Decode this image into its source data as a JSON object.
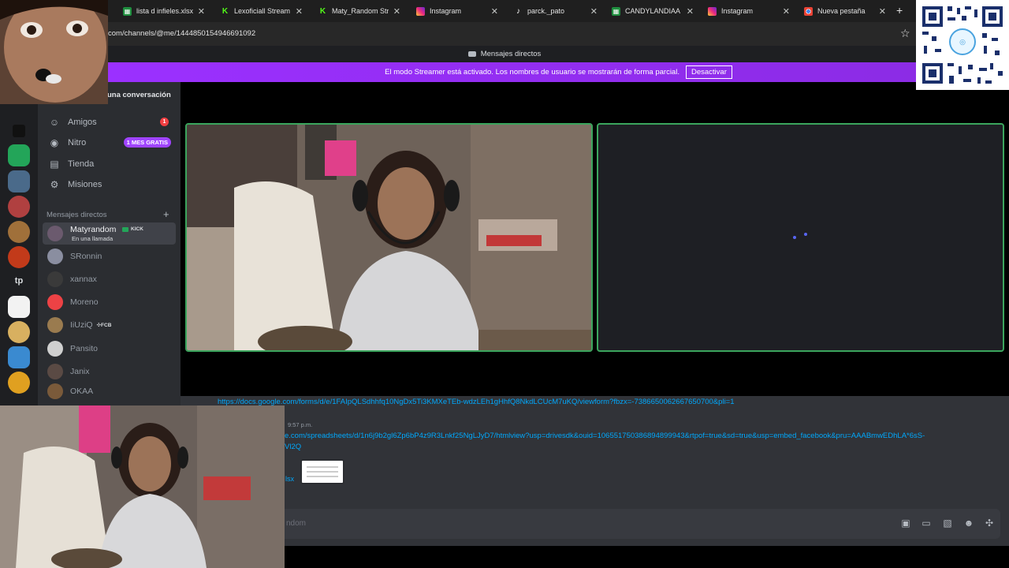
{
  "browser": {
    "tabs": [
      {
        "label": "lista d infieles.xlsx - G",
        "favicon": "sheets-icon"
      },
      {
        "label": "Lexoficiall Stream - W",
        "favicon": "kick-icon"
      },
      {
        "label": "Maty_Random Stream",
        "favicon": "kick-icon"
      },
      {
        "label": "Instagram",
        "favicon": "instagram-icon"
      },
      {
        "label": "parck._pato",
        "favicon": "tiktok-icon"
      },
      {
        "label": "CANDYLANDIAA",
        "favicon": "sheets-icon"
      },
      {
        "label": "Instagram",
        "favicon": "instagram-icon"
      },
      {
        "label": "Nueva pestaña",
        "favicon": "chrome-icon"
      }
    ],
    "url": "com/channels/@me/1444850154946691092"
  },
  "header": {
    "title": "Mensajes directos"
  },
  "streamer_mode": {
    "message": "El modo Streamer está activado. Los nombres de usuario se mostrarán de forma parcial.",
    "button": "Desactivar"
  },
  "sidebar": {
    "find_label": "una conversación",
    "nav": [
      {
        "label": "Amigos",
        "badge": "1"
      },
      {
        "label": "Nitro",
        "badge": "1 MES GRATIS"
      },
      {
        "label": "Tienda"
      },
      {
        "label": "Misiones"
      }
    ],
    "dm_title": "Mensajes directos",
    "dms": [
      {
        "name": "Matyrandom",
        "tag": "KICK",
        "status": "En una llamada",
        "color": "#6b5a6e"
      },
      {
        "name": "SRonnin",
        "color": "#8a8ea0"
      },
      {
        "name": "xannax",
        "color": "#3a3a3a"
      },
      {
        "name": "Moreno",
        "color": "#ed4245"
      },
      {
        "name": "IiUziQ",
        "tag": "FCB",
        "color": "#9a7b4f"
      },
      {
        "name": "Pansito",
        "color": "#d0d0d0"
      },
      {
        "name": "Janix",
        "color": "#5a4a44"
      },
      {
        "name": "OKAA",
        "color": "#7a5a3a"
      }
    ]
  },
  "chat": {
    "link1": "https://docs.google.com/forms/d/e/1FAIpQLSdhhfq10NgDx5Ti3KMXeTEb-wdzLEh1gHhfQ8NkdLCUcM7uKQ/viewform?fbzx=-7386650062667650700&pli=1",
    "time": "9:57 p.m.",
    "link2a": "e.com/spreadsheets/d/1n6j9b2gl6Zp6bP4z9R3Lnkf25NgLJyD7/htmlview?usp=drivesdk&ouid=106551750386894899943&rtpof=true&sd=true&usp=embed_facebook&pru=AAABmwEDhLA*6sS-",
    "link2b": "Vl2Q",
    "attachment": "lsx",
    "placeholder": "ndom"
  },
  "colors": {
    "accent": "#8a2be2",
    "call_border": "#3ba55d",
    "link": "#00a8fc"
  }
}
